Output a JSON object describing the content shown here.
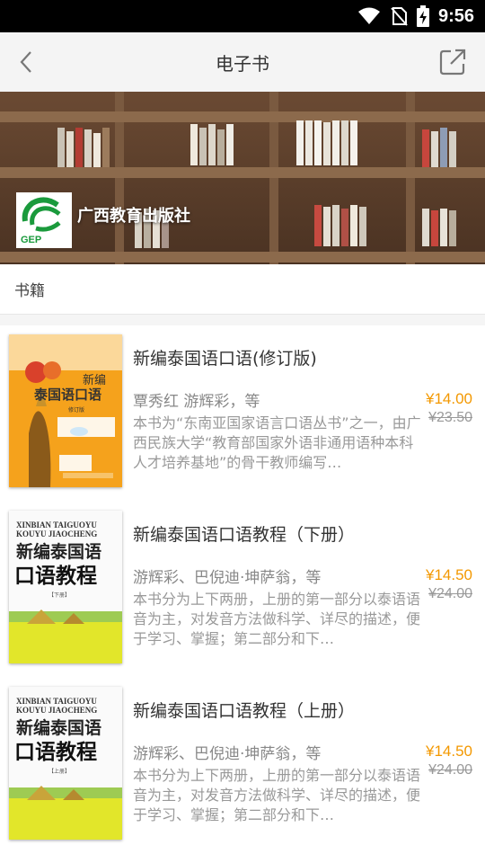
{
  "status": {
    "time": "9:56"
  },
  "nav": {
    "title": "电子书"
  },
  "banner": {
    "publisher": "广西教育出版社",
    "logo_text": "GEP"
  },
  "section": {
    "title": "书籍"
  },
  "books": [
    {
      "name": "新编泰国语口语(修订版)",
      "author": "覃秀红  游辉彩，等",
      "price": "¥14.00",
      "old_price": "¥23.50",
      "desc": "本书为“东南亚国家语言口语丛书”之一，由广西民族大学“教育部国家外语非通用语种本科人才培养基地”的骨干教师编写…",
      "cover_title": "泰国语口语",
      "cover_top": "新编",
      "cover_edition": "修订版"
    },
    {
      "name": "新编泰国语口语教程（下册）",
      "author": "游辉彩、巴倪迪·坤萨翁，等",
      "price": "¥14.50",
      "old_price": "¥24.00",
      "desc": "本书分为上下两册，上册的第一部分以泰语语音为主，对发音方法做科学、详尽的描述，便于学习、掌握；第二部分和下…",
      "cover_pinyin1": "XINBIAN TAIGUOYU",
      "cover_pinyin2": "KOUYU JIAOCHENG",
      "cover_title1": "新编泰国语",
      "cover_title2": "口语教程",
      "cover_volume": "【下册】"
    },
    {
      "name": "新编泰国语口语教程（上册）",
      "author": "游辉彩、巴倪迪·坤萨翁，等",
      "price": "¥14.50",
      "old_price": "¥24.00",
      "desc": "本书分为上下两册，上册的第一部分以泰语语音为主，对发音方法做科学、详尽的描述，便于学习、掌握；第二部分和下…",
      "cover_pinyin1": "XINBIAN TAIGUOYU",
      "cover_pinyin2": "KOUYU JIAOCHENG",
      "cover_title1": "新编泰国语",
      "cover_title2": "口语教程",
      "cover_volume": "【上册】"
    }
  ],
  "colors": {
    "accent_price": "#f39800",
    "nav_bg": "#f4f4f4",
    "logo_green": "#1a9a3c"
  },
  "icons": {
    "back": "chevron-left-icon",
    "share": "share-external-icon"
  }
}
